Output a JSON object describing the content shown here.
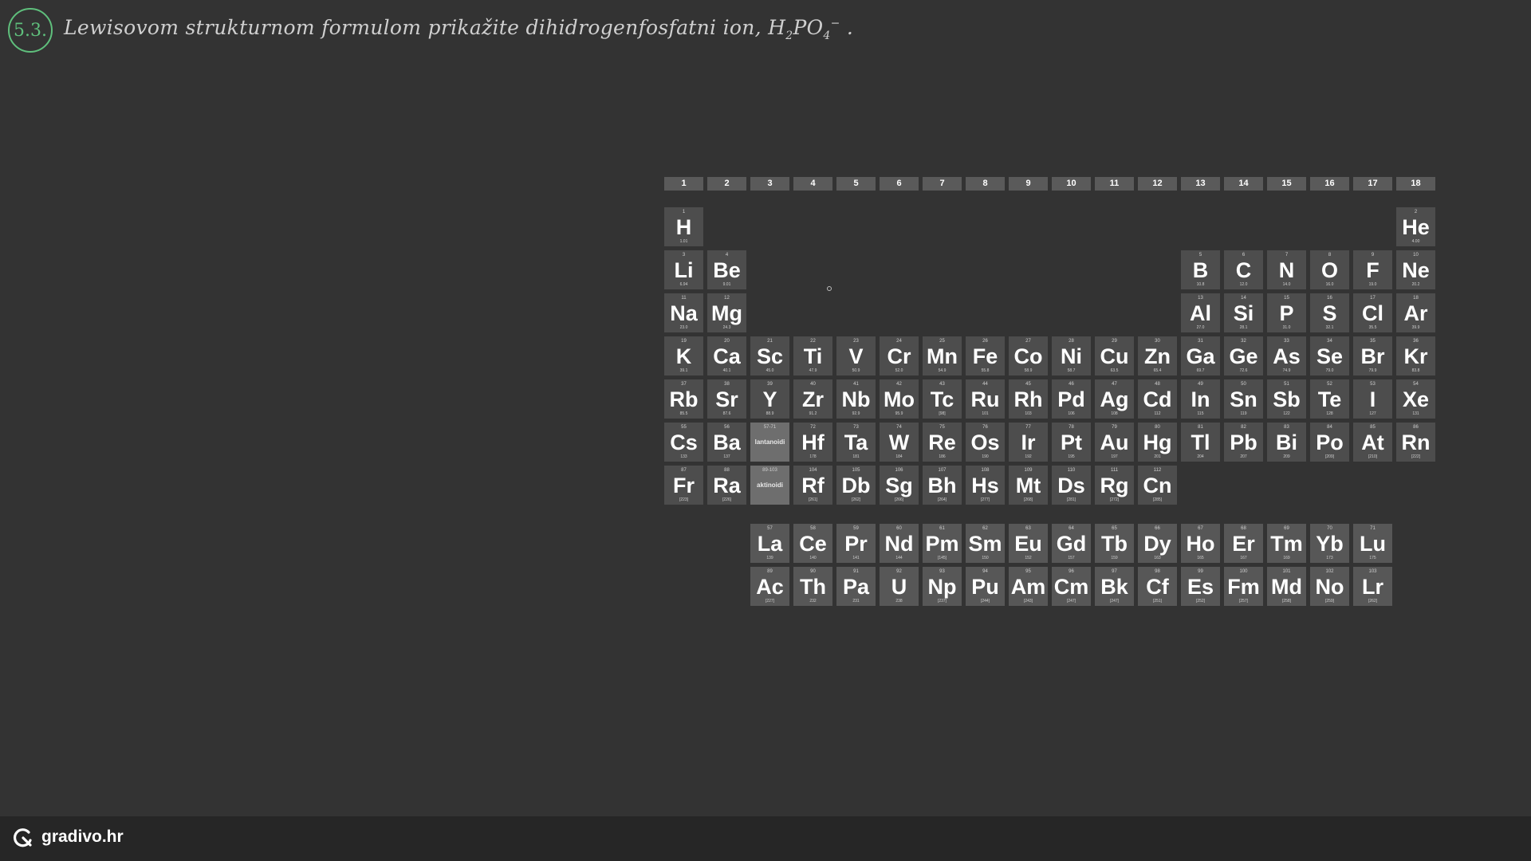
{
  "question": {
    "number": "5.3.",
    "text_before": "Lewisovom strukturnom formulom prikažite dihidrogenfosfatni ion, H",
    "sub1": "2",
    "mid": "PO",
    "sub2": "4",
    "sup": "−",
    "text_after": " ."
  },
  "periodic_table": {
    "groups": [
      "1",
      "2",
      "3",
      "4",
      "5",
      "6",
      "7",
      "8",
      "9",
      "10",
      "11",
      "12",
      "13",
      "14",
      "15",
      "16",
      "17",
      "18"
    ],
    "elements": [
      {
        "sym": "H",
        "num": "1",
        "mass": "1.01",
        "col": 1,
        "row": 1
      },
      {
        "sym": "He",
        "num": "2",
        "mass": "4.00",
        "col": 18,
        "row": 1
      },
      {
        "sym": "Li",
        "num": "3",
        "mass": "6.94",
        "col": 1,
        "row": 2
      },
      {
        "sym": "Be",
        "num": "4",
        "mass": "9.01",
        "col": 2,
        "row": 2
      },
      {
        "sym": "B",
        "num": "5",
        "mass": "10.8",
        "col": 13,
        "row": 2
      },
      {
        "sym": "C",
        "num": "6",
        "mass": "12.0",
        "col": 14,
        "row": 2
      },
      {
        "sym": "N",
        "num": "7",
        "mass": "14.0",
        "col": 15,
        "row": 2
      },
      {
        "sym": "O",
        "num": "8",
        "mass": "16.0",
        "col": 16,
        "row": 2
      },
      {
        "sym": "F",
        "num": "9",
        "mass": "19.0",
        "col": 17,
        "row": 2
      },
      {
        "sym": "Ne",
        "num": "10",
        "mass": "20.2",
        "col": 18,
        "row": 2
      },
      {
        "sym": "Na",
        "num": "11",
        "mass": "23.0",
        "col": 1,
        "row": 3
      },
      {
        "sym": "Mg",
        "num": "12",
        "mass": "24.3",
        "col": 2,
        "row": 3
      },
      {
        "sym": "Al",
        "num": "13",
        "mass": "27.0",
        "col": 13,
        "row": 3
      },
      {
        "sym": "Si",
        "num": "14",
        "mass": "28.1",
        "col": 14,
        "row": 3
      },
      {
        "sym": "P",
        "num": "15",
        "mass": "31.0",
        "col": 15,
        "row": 3
      },
      {
        "sym": "S",
        "num": "16",
        "mass": "32.1",
        "col": 16,
        "row": 3
      },
      {
        "sym": "Cl",
        "num": "17",
        "mass": "35.5",
        "col": 17,
        "row": 3
      },
      {
        "sym": "Ar",
        "num": "18",
        "mass": "39.9",
        "col": 18,
        "row": 3
      },
      {
        "sym": "K",
        "num": "19",
        "mass": "39.1",
        "col": 1,
        "row": 4
      },
      {
        "sym": "Ca",
        "num": "20",
        "mass": "40.1",
        "col": 2,
        "row": 4
      },
      {
        "sym": "Sc",
        "num": "21",
        "mass": "45.0",
        "col": 3,
        "row": 4
      },
      {
        "sym": "Ti",
        "num": "22",
        "mass": "47.9",
        "col": 4,
        "row": 4
      },
      {
        "sym": "V",
        "num": "23",
        "mass": "50.9",
        "col": 5,
        "row": 4
      },
      {
        "sym": "Cr",
        "num": "24",
        "mass": "52.0",
        "col": 6,
        "row": 4
      },
      {
        "sym": "Mn",
        "num": "25",
        "mass": "54.9",
        "col": 7,
        "row": 4
      },
      {
        "sym": "Fe",
        "num": "26",
        "mass": "55.8",
        "col": 8,
        "row": 4
      },
      {
        "sym": "Co",
        "num": "27",
        "mass": "58.9",
        "col": 9,
        "row": 4
      },
      {
        "sym": "Ni",
        "num": "28",
        "mass": "58.7",
        "col": 10,
        "row": 4
      },
      {
        "sym": "Cu",
        "num": "29",
        "mass": "63.5",
        "col": 11,
        "row": 4
      },
      {
        "sym": "Zn",
        "num": "30",
        "mass": "65.4",
        "col": 12,
        "row": 4
      },
      {
        "sym": "Ga",
        "num": "31",
        "mass": "69.7",
        "col": 13,
        "row": 4
      },
      {
        "sym": "Ge",
        "num": "32",
        "mass": "72.6",
        "col": 14,
        "row": 4
      },
      {
        "sym": "As",
        "num": "33",
        "mass": "74.9",
        "col": 15,
        "row": 4
      },
      {
        "sym": "Se",
        "num": "34",
        "mass": "79.0",
        "col": 16,
        "row": 4
      },
      {
        "sym": "Br",
        "num": "35",
        "mass": "79.9",
        "col": 17,
        "row": 4
      },
      {
        "sym": "Kr",
        "num": "36",
        "mass": "83.8",
        "col": 18,
        "row": 4
      },
      {
        "sym": "Rb",
        "num": "37",
        "mass": "85.5",
        "col": 1,
        "row": 5
      },
      {
        "sym": "Sr",
        "num": "38",
        "mass": "87.6",
        "col": 2,
        "row": 5
      },
      {
        "sym": "Y",
        "num": "39",
        "mass": "88.9",
        "col": 3,
        "row": 5
      },
      {
        "sym": "Zr",
        "num": "40",
        "mass": "91.2",
        "col": 4,
        "row": 5
      },
      {
        "sym": "Nb",
        "num": "41",
        "mass": "92.9",
        "col": 5,
        "row": 5
      },
      {
        "sym": "Mo",
        "num": "42",
        "mass": "95.9",
        "col": 6,
        "row": 5
      },
      {
        "sym": "Tc",
        "num": "43",
        "mass": "[98]",
        "col": 7,
        "row": 5
      },
      {
        "sym": "Ru",
        "num": "44",
        "mass": "101",
        "col": 8,
        "row": 5
      },
      {
        "sym": "Rh",
        "num": "45",
        "mass": "103",
        "col": 9,
        "row": 5
      },
      {
        "sym": "Pd",
        "num": "46",
        "mass": "106",
        "col": 10,
        "row": 5
      },
      {
        "sym": "Ag",
        "num": "47",
        "mass": "108",
        "col": 11,
        "row": 5
      },
      {
        "sym": "Cd",
        "num": "48",
        "mass": "112",
        "col": 12,
        "row": 5
      },
      {
        "sym": "In",
        "num": "49",
        "mass": "115",
        "col": 13,
        "row": 5
      },
      {
        "sym": "Sn",
        "num": "50",
        "mass": "119",
        "col": 14,
        "row": 5
      },
      {
        "sym": "Sb",
        "num": "51",
        "mass": "122",
        "col": 15,
        "row": 5
      },
      {
        "sym": "Te",
        "num": "52",
        "mass": "128",
        "col": 16,
        "row": 5
      },
      {
        "sym": "I",
        "num": "53",
        "mass": "127",
        "col": 17,
        "row": 5
      },
      {
        "sym": "Xe",
        "num": "54",
        "mass": "131",
        "col": 18,
        "row": 5
      },
      {
        "sym": "Cs",
        "num": "55",
        "mass": "133",
        "col": 1,
        "row": 6
      },
      {
        "sym": "Ba",
        "num": "56",
        "mass": "137",
        "col": 2,
        "row": 6
      },
      {
        "sym": "lantanoidi",
        "num": "57-71",
        "mass": "",
        "col": 3,
        "row": 6,
        "placeholder": true
      },
      {
        "sym": "Hf",
        "num": "72",
        "mass": "178",
        "col": 4,
        "row": 6
      },
      {
        "sym": "Ta",
        "num": "73",
        "mass": "181",
        "col": 5,
        "row": 6
      },
      {
        "sym": "W",
        "num": "74",
        "mass": "184",
        "col": 6,
        "row": 6
      },
      {
        "sym": "Re",
        "num": "75",
        "mass": "186",
        "col": 7,
        "row": 6
      },
      {
        "sym": "Os",
        "num": "76",
        "mass": "190",
        "col": 8,
        "row": 6
      },
      {
        "sym": "Ir",
        "num": "77",
        "mass": "192",
        "col": 9,
        "row": 6
      },
      {
        "sym": "Pt",
        "num": "78",
        "mass": "195",
        "col": 10,
        "row": 6
      },
      {
        "sym": "Au",
        "num": "79",
        "mass": "197",
        "col": 11,
        "row": 6
      },
      {
        "sym": "Hg",
        "num": "80",
        "mass": "201",
        "col": 12,
        "row": 6
      },
      {
        "sym": "Tl",
        "num": "81",
        "mass": "204",
        "col": 13,
        "row": 6
      },
      {
        "sym": "Pb",
        "num": "82",
        "mass": "207",
        "col": 14,
        "row": 6
      },
      {
        "sym": "Bi",
        "num": "83",
        "mass": "209",
        "col": 15,
        "row": 6
      },
      {
        "sym": "Po",
        "num": "84",
        "mass": "[209]",
        "col": 16,
        "row": 6
      },
      {
        "sym": "At",
        "num": "85",
        "mass": "[210]",
        "col": 17,
        "row": 6
      },
      {
        "sym": "Rn",
        "num": "86",
        "mass": "[222]",
        "col": 18,
        "row": 6
      },
      {
        "sym": "Fr",
        "num": "87",
        "mass": "[223]",
        "col": 1,
        "row": 7
      },
      {
        "sym": "Ra",
        "num": "88",
        "mass": "[226]",
        "col": 2,
        "row": 7
      },
      {
        "sym": "aktinoidi",
        "num": "89-103",
        "mass": "",
        "col": 3,
        "row": 7,
        "placeholder": true
      },
      {
        "sym": "Rf",
        "num": "104",
        "mass": "[261]",
        "col": 4,
        "row": 7
      },
      {
        "sym": "Db",
        "num": "105",
        "mass": "[262]",
        "col": 5,
        "row": 7
      },
      {
        "sym": "Sg",
        "num": "106",
        "mass": "[266]",
        "col": 6,
        "row": 7
      },
      {
        "sym": "Bh",
        "num": "107",
        "mass": "[264]",
        "col": 7,
        "row": 7
      },
      {
        "sym": "Hs",
        "num": "108",
        "mass": "[277]",
        "col": 8,
        "row": 7
      },
      {
        "sym": "Mt",
        "num": "109",
        "mass": "[268]",
        "col": 9,
        "row": 7
      },
      {
        "sym": "Ds",
        "num": "110",
        "mass": "[281]",
        "col": 10,
        "row": 7
      },
      {
        "sym": "Rg",
        "num": "111",
        "mass": "[272]",
        "col": 11,
        "row": 7
      },
      {
        "sym": "Cn",
        "num": "112",
        "mass": "[285]",
        "col": 12,
        "row": 7
      },
      {
        "sym": "La",
        "num": "57",
        "mass": "139",
        "col": 3,
        "row": 8
      },
      {
        "sym": "Ce",
        "num": "58",
        "mass": "140",
        "col": 4,
        "row": 8
      },
      {
        "sym": "Pr",
        "num": "59",
        "mass": "141",
        "col": 5,
        "row": 8
      },
      {
        "sym": "Nd",
        "num": "60",
        "mass": "144",
        "col": 6,
        "row": 8
      },
      {
        "sym": "Pm",
        "num": "61",
        "mass": "[145]",
        "col": 7,
        "row": 8
      },
      {
        "sym": "Sm",
        "num": "62",
        "mass": "150",
        "col": 8,
        "row": 8
      },
      {
        "sym": "Eu",
        "num": "63",
        "mass": "152",
        "col": 9,
        "row": 8
      },
      {
        "sym": "Gd",
        "num": "64",
        "mass": "157",
        "col": 10,
        "row": 8
      },
      {
        "sym": "Tb",
        "num": "65",
        "mass": "159",
        "col": 11,
        "row": 8
      },
      {
        "sym": "Dy",
        "num": "66",
        "mass": "163",
        "col": 12,
        "row": 8
      },
      {
        "sym": "Ho",
        "num": "67",
        "mass": "165",
        "col": 13,
        "row": 8
      },
      {
        "sym": "Er",
        "num": "68",
        "mass": "167",
        "col": 14,
        "row": 8
      },
      {
        "sym": "Tm",
        "num": "69",
        "mass": "169",
        "col": 15,
        "row": 8
      },
      {
        "sym": "Yb",
        "num": "70",
        "mass": "173",
        "col": 16,
        "row": 8
      },
      {
        "sym": "Lu",
        "num": "71",
        "mass": "175",
        "col": 17,
        "row": 8
      },
      {
        "sym": "Ac",
        "num": "89",
        "mass": "[227]",
        "col": 3,
        "row": 9
      },
      {
        "sym": "Th",
        "num": "90",
        "mass": "232",
        "col": 4,
        "row": 9
      },
      {
        "sym": "Pa",
        "num": "91",
        "mass": "231",
        "col": 5,
        "row": 9
      },
      {
        "sym": "U",
        "num": "92",
        "mass": "238",
        "col": 6,
        "row": 9
      },
      {
        "sym": "Np",
        "num": "93",
        "mass": "[237]",
        "col": 7,
        "row": 9
      },
      {
        "sym": "Pu",
        "num": "94",
        "mass": "[244]",
        "col": 8,
        "row": 9
      },
      {
        "sym": "Am",
        "num": "95",
        "mass": "[243]",
        "col": 9,
        "row": 9
      },
      {
        "sym": "Cm",
        "num": "96",
        "mass": "[247]",
        "col": 10,
        "row": 9
      },
      {
        "sym": "Bk",
        "num": "97",
        "mass": "[247]",
        "col": 11,
        "row": 9
      },
      {
        "sym": "Cf",
        "num": "98",
        "mass": "[251]",
        "col": 12,
        "row": 9
      },
      {
        "sym": "Es",
        "num": "99",
        "mass": "[252]",
        "col": 13,
        "row": 9
      },
      {
        "sym": "Fm",
        "num": "100",
        "mass": "[257]",
        "col": 14,
        "row": 9
      },
      {
        "sym": "Md",
        "num": "101",
        "mass": "[258]",
        "col": 15,
        "row": 9
      },
      {
        "sym": "No",
        "num": "102",
        "mass": "[259]",
        "col": 16,
        "row": 9
      },
      {
        "sym": "Lr",
        "num": "103",
        "mass": "[262]",
        "col": 17,
        "row": 9
      }
    ]
  },
  "footer": {
    "brand": "gradivo.hr",
    "icon": "gradivo-logo-icon"
  },
  "colors": {
    "background": "#333333",
    "accent": "#5fbf7c",
    "tile": "#4d4d4d",
    "footer": "#262626"
  }
}
